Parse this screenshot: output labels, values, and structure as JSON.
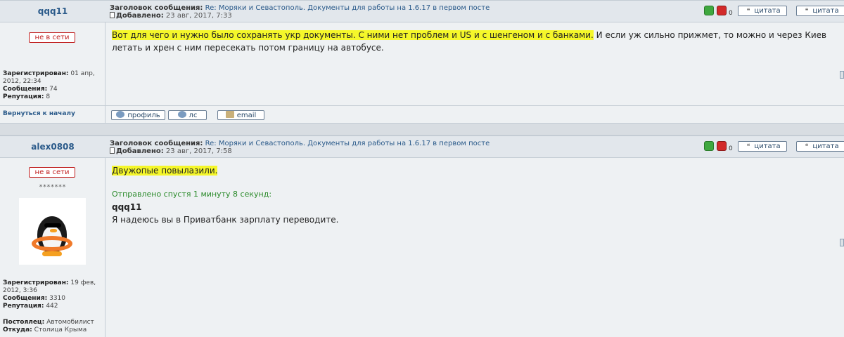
{
  "labels": {
    "subject_prefix": "Заголовок сообщения:",
    "added_prefix": "Добавлено:",
    "quote": "цитата",
    "offline": "не в сети",
    "registered": "Зарегистрирован:",
    "messages": "Сообщения:",
    "reputation": "Репутация:",
    "occupation": "Постоялец:",
    "from": "Откуда:",
    "back_to_top": "Вернуться к началу",
    "profile": "профиль",
    "pm": "лс",
    "email": "email"
  },
  "posts": [
    {
      "author": "qqq11",
      "subject": "Re: Моряки и Севастополь. Документы для работы на 1.6.17 в первом посте",
      "date": "23 авг, 2017, 7:33",
      "votes": "0",
      "registered_line1": "01 апр,",
      "registered_line2": "2012, 22:34",
      "messages": "74",
      "reputation": "8",
      "body_highlight": "Вот для чего и нужно было сохранять укр документы. С ними нет проблем и US и с шенгеном и с банками.",
      "body_rest": " И если уж сильно прижмет, то можно и через Киев",
      "body_line2": "летать и хрен с ним пересекать потом границу на автобусе."
    },
    {
      "author": "alex0808",
      "subject": "Re: Моряки и Севастополь. Документы для работы на 1.6.17 в первом посте",
      "date": "23 авг, 2017, 7:58",
      "votes": "0",
      "stars": "*******",
      "registered_line1": "19 фев,",
      "registered_line2": "2012, 3:36",
      "messages": "3310",
      "reputation": "442",
      "occupation": "Автомобилист",
      "from": "Столица Крыма",
      "body_highlight": "Двужопые повылазили.",
      "edit_note": "Отправлено спустя 1 минуту 8 секунд:",
      "quote_author": "qqq11",
      "quote_text": "Я надеюсь вы в Приватбанк зарплату переводите."
    }
  ]
}
